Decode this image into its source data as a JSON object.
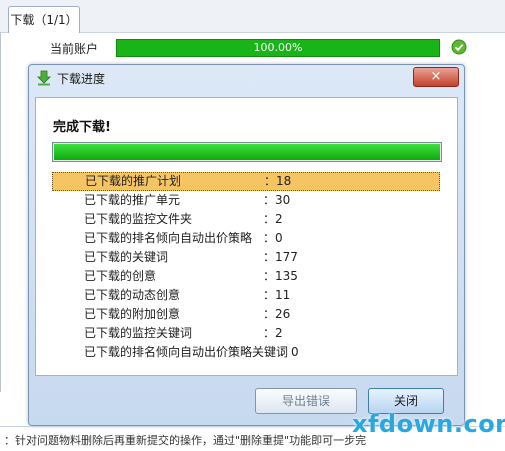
{
  "tabs": [
    {
      "label": "下载（1/1）"
    }
  ],
  "account": {
    "label": "当前账户",
    "progress_text": "100.00%",
    "progress": 1.0
  },
  "dialog": {
    "title": "下载进度",
    "close_label": "×",
    "status": "完成下载!",
    "progress": 1.0,
    "stats": [
      {
        "label": "已下载的推广计划",
        "value": "：18"
      },
      {
        "label": "已下载的推广单元",
        "value": "：30"
      },
      {
        "label": "已下载的监控文件夹",
        "value": "：2"
      },
      {
        "label": "已下载的排名倾向自动出价策略",
        "value": "：0"
      },
      {
        "label": "已下载的关键词",
        "value": "：177"
      },
      {
        "label": "已下载的创意",
        "value": "：135"
      },
      {
        "label": "已下载的动态创意",
        "value": "：11"
      },
      {
        "label": "已下载的附加创意",
        "value": "：26"
      },
      {
        "label": "已下载的监控关键词",
        "value": "：2"
      },
      {
        "label": "已下载的排名倾向自动出价策略关键词",
        "value": "：0"
      }
    ],
    "export_button": "导出错误",
    "close_button": "关闭"
  },
  "bottom_hint": "：针对问题物料删除后再重新提交的操作，通过\"删除重提\"功能即可一步完",
  "watermark": "xfdown.com",
  "colors": {
    "progress_green": "#18b418",
    "selected_row": "#f5c463",
    "watermark": "#28a8e0"
  }
}
